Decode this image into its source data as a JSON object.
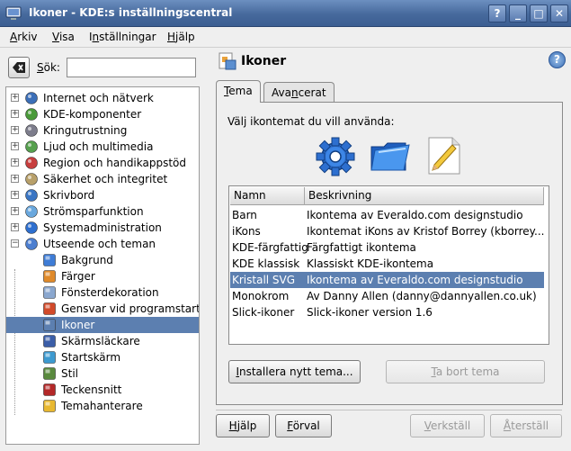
{
  "window": {
    "title": "Ikoner - KDE:s inställningscentral",
    "controls": [
      "?",
      "_",
      "□",
      "✕"
    ]
  },
  "menu": [
    {
      "label": "Arkiv",
      "accel": "A"
    },
    {
      "label": "Visa",
      "accel": "V"
    },
    {
      "label": "Inställningar",
      "accel": "n"
    },
    {
      "label": "Hjälp",
      "accel": "H"
    }
  ],
  "search": {
    "label": "Sök:",
    "value": ""
  },
  "tree": {
    "categories": [
      {
        "label": "Internet och nätverk",
        "icon": "globe-icon"
      },
      {
        "label": "KDE-komponenter",
        "icon": "components-icon"
      },
      {
        "label": "Kringutrustning",
        "icon": "mouse-icon"
      },
      {
        "label": "Ljud och multimedia",
        "icon": "speaker-icon"
      },
      {
        "label": "Region och handikappstöd",
        "icon": "flag-icon"
      },
      {
        "label": "Säkerhet och integritet",
        "icon": "keys-icon"
      },
      {
        "label": "Skrivbord",
        "icon": "desktop-icon"
      },
      {
        "label": "Strömsparfunktion",
        "icon": "battery-icon"
      },
      {
        "label": "Systemadministration",
        "icon": "sysadmin-icon"
      },
      {
        "label": "Utseende och teman",
        "icon": "appearance-icon"
      }
    ],
    "children": [
      {
        "label": "Bakgrund",
        "icon": "background-icon"
      },
      {
        "label": "Färger",
        "icon": "colors-icon"
      },
      {
        "label": "Fönsterdekoration",
        "icon": "window-decoration-icon"
      },
      {
        "label": "Gensvar vid programstart",
        "icon": "launch-feedback-icon"
      },
      {
        "label": "Ikoner",
        "icon": "icons-icon",
        "selected": true
      },
      {
        "label": "Skärmsläckare",
        "icon": "screensaver-icon"
      },
      {
        "label": "Startskärm",
        "icon": "splash-icon"
      },
      {
        "label": "Stil",
        "icon": "style-icon"
      },
      {
        "label": "Teckensnitt",
        "icon": "fonts-icon"
      },
      {
        "label": "Temahanterare",
        "icon": "theme-manager-icon"
      }
    ]
  },
  "module": {
    "title": "Ikoner"
  },
  "tabs": [
    {
      "label": "Tema",
      "accel": "T",
      "active": true
    },
    {
      "label": "Avancerat",
      "accel": "n"
    }
  ],
  "theme_tab": {
    "prompt": "Välj ikontemat du vill använda:",
    "preview_icons": [
      "gear-icon",
      "folder-icon",
      "document-edit-icon"
    ],
    "columns": [
      "Namn",
      "Beskrivning"
    ],
    "themes": [
      {
        "name": "Barn",
        "desc": "Ikontema av Everaldo.com designstudio"
      },
      {
        "name": "iKons",
        "desc": "Ikontemat iKons av Kristof Borrey (kborrey..."
      },
      {
        "name": "KDE-färgfattig",
        "desc": "Färgfattigt ikontema"
      },
      {
        "name": "KDE klassisk",
        "desc": "Klassiskt KDE-ikontema"
      },
      {
        "name": "Kristall SVG",
        "desc": "Ikontema av Everaldo.com designstudio",
        "selected": true
      },
      {
        "name": "Monokrom",
        "desc": "Av Danny Allen (danny@dannyallen.co.uk)"
      },
      {
        "name": "Slick-ikoner",
        "desc": "Slick-ikoner version 1.6"
      }
    ],
    "install_button": "Installera nytt tema...",
    "remove_button": "Ta bort tema"
  },
  "footer": {
    "help": "Hjälp",
    "defaults": "Förval",
    "apply": "Verkställ",
    "reset": "Återställ"
  },
  "colors": {
    "selection": "#5c7fb0",
    "titlebar": "#46699c"
  }
}
